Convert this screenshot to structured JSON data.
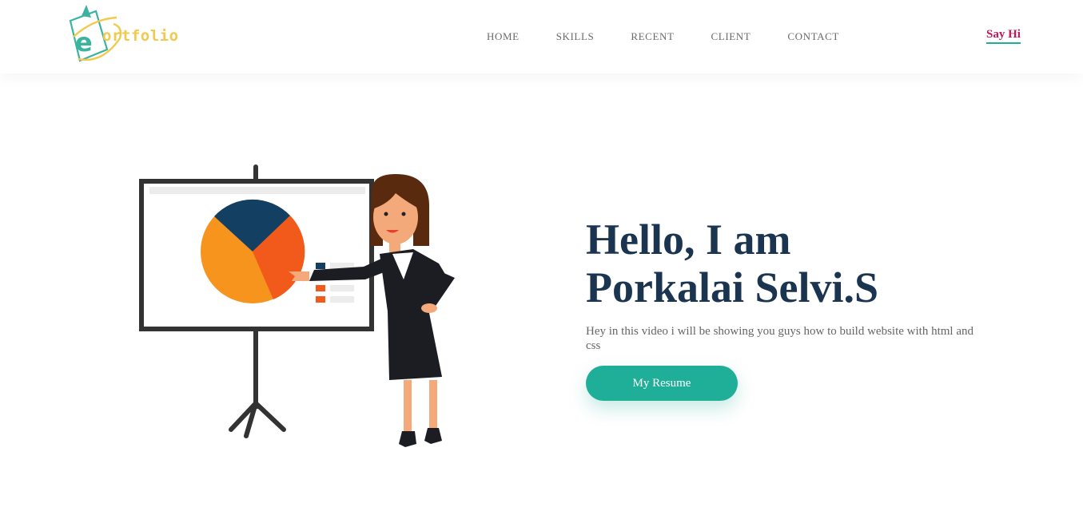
{
  "header": {
    "logo": {
      "letter": "e",
      "text": "ortfolio",
      "icon": "eportfolio-logo-icon"
    },
    "nav": [
      {
        "label": "HOME"
      },
      {
        "label": "SKILLS"
      },
      {
        "label": "RECENT"
      },
      {
        "label": "CLIENT"
      },
      {
        "label": "CONTACT"
      }
    ],
    "say_hi": "Say Hi"
  },
  "hero": {
    "title_line1": "Hello, I am",
    "title_line2": "Porkalai Selvi.S",
    "description": "Hey in this video i will be showing you guys how to build website with html and css",
    "button": "My Resume",
    "illustration": "presenter-with-pie-chart-illustration"
  },
  "colors": {
    "accent": "#1fae97",
    "say_hi": "#c2185b",
    "title": "#1b3550",
    "logo_yellow": "#f2c94c",
    "logo_teal": "#3bb3a0"
  }
}
